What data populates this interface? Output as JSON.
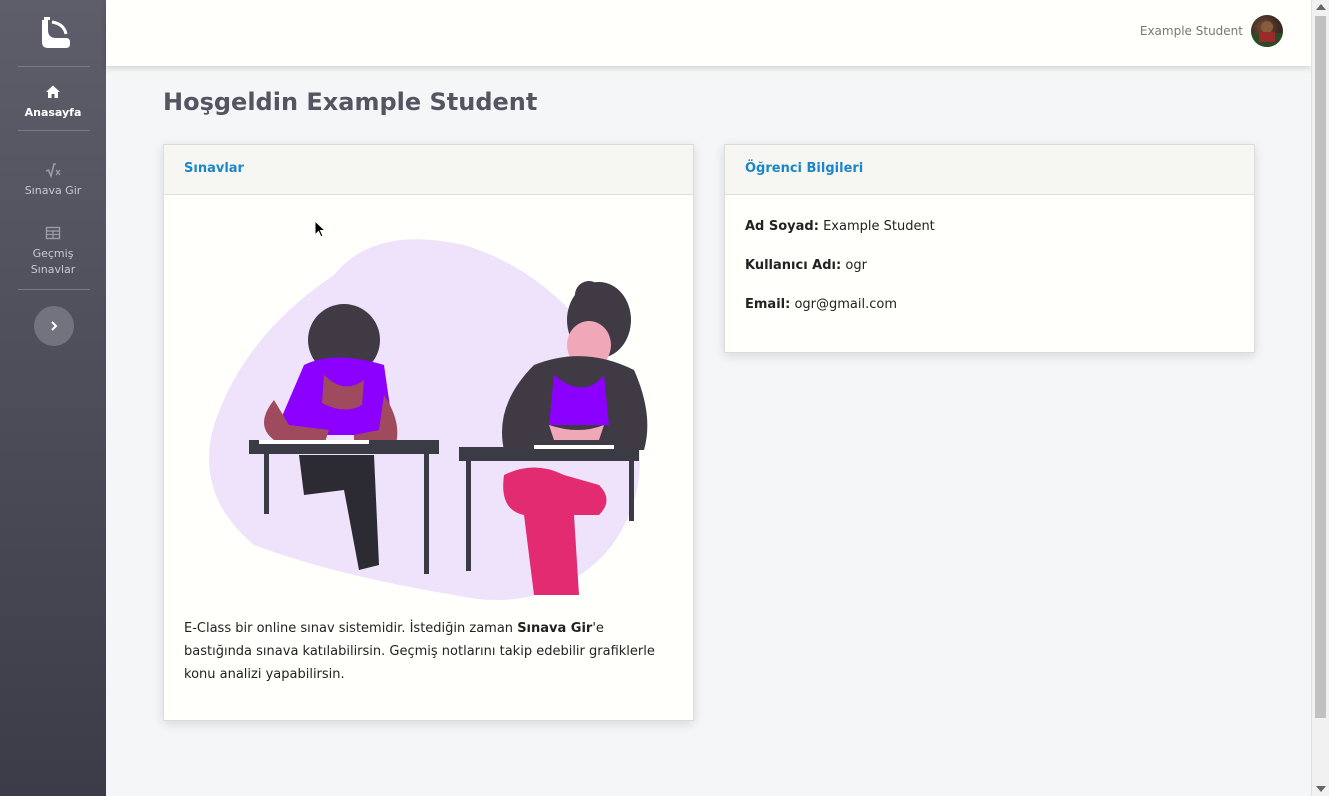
{
  "sidebar": {
    "items": [
      {
        "label": "Anasayfa",
        "icon": "home-icon",
        "active": true
      },
      {
        "label": "Sınava Gir",
        "icon": "square-root-icon",
        "active": false
      },
      {
        "label": "Geçmiş Sınavlar",
        "icon": "table-icon",
        "active": false
      }
    ],
    "toggle_icon": "chevron-right-icon"
  },
  "header": {
    "user_name": "Example Student"
  },
  "main": {
    "title": "Hoşgeldin Example Student",
    "exams_card": {
      "title": "Sınavlar",
      "text_before": "E-Class bir online sınav sistemidir. İstediğin zaman ",
      "text_bold": "Sınava Gir",
      "text_after": "'e bastığında sınava katılabilirsin. Geçmiş notlarını takip edebilir grafiklerle konu analizi yapabilirsin."
    },
    "student_card": {
      "title": "Öğrenci Bilgileri",
      "fields": [
        {
          "label": "Ad Soyad:",
          "value": "Example Student"
        },
        {
          "label": "Kullanıcı Adı:",
          "value": "ogr"
        },
        {
          "label": "Email:",
          "value": "ogr@gmail.com"
        }
      ]
    }
  },
  "colors": {
    "accent": "#1c86c8",
    "sidebar_top": "#5e5e6b",
    "sidebar_bottom": "#3c3b48",
    "illustration_blob": "#efe3fb",
    "shirt_purple": "#8b00ff",
    "pants_pink": "#e32b72"
  }
}
